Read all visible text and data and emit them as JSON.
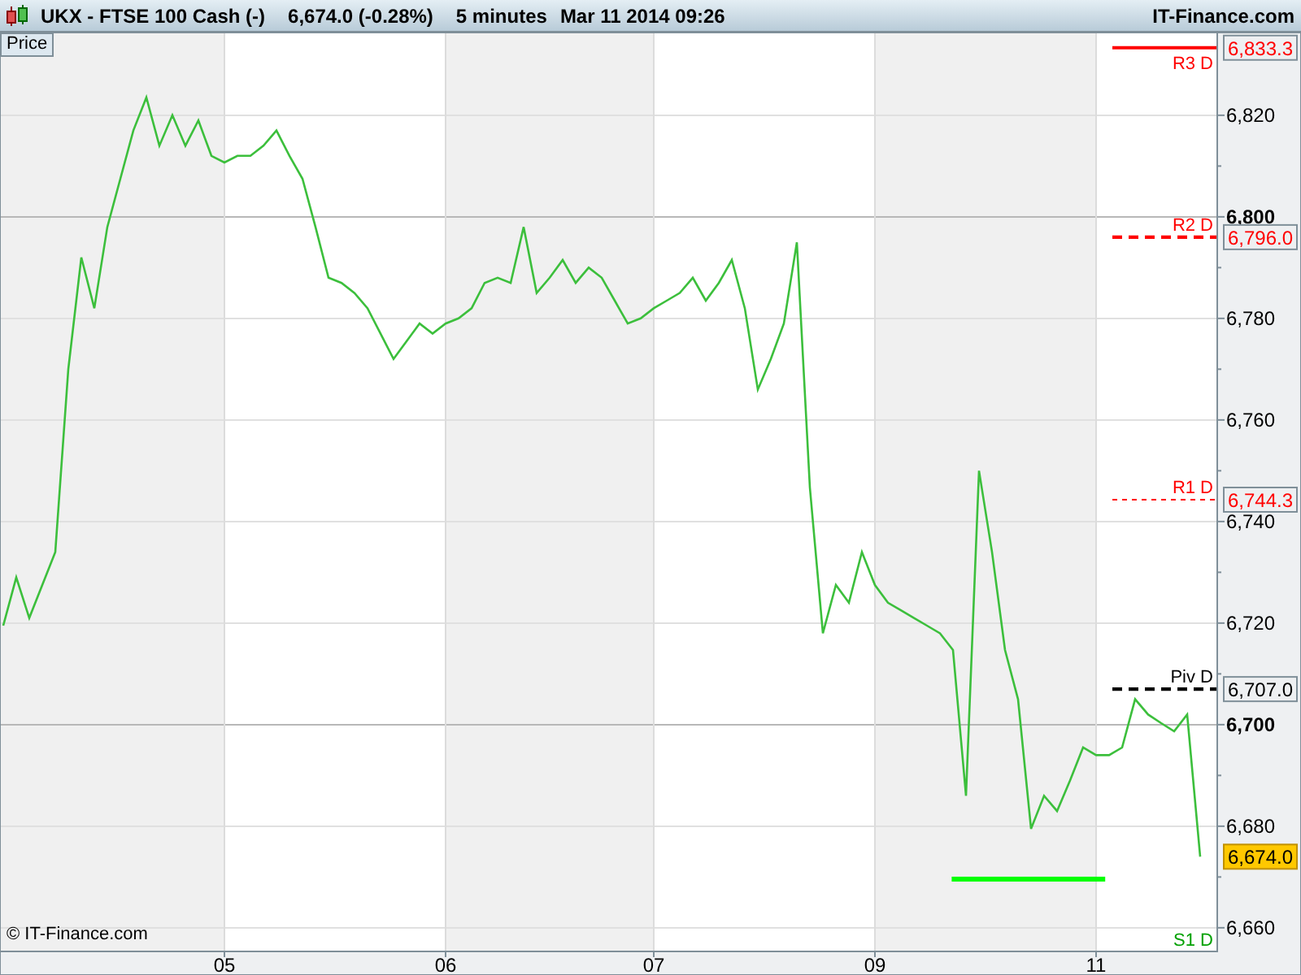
{
  "header": {
    "instrument": "UKX - FTSE 100 Cash (-)",
    "quote": "6,674.0 (-0.28%)",
    "interval": "5 minutes",
    "timestamp": "Mar 11 2014 09:26",
    "brand": "IT-Finance.com"
  },
  "chart": {
    "panel_label": "Price",
    "watermark": "© IT-Finance.com",
    "bottom_level_label": "S1 D",
    "price_tags": [
      {
        "kind": "level",
        "text": "6,833.3"
      },
      {
        "kind": "level",
        "text": "6,796.0"
      },
      {
        "kind": "level",
        "text": "6,744.3"
      },
      {
        "kind": "level",
        "text": "6,707.0"
      },
      {
        "kind": "last",
        "text": "6,674.0",
        "color": "#ffc800"
      }
    ],
    "chart_data": {
      "type": "line",
      "grid": true,
      "ylim": [
        6655.5,
        6836.3
      ],
      "categories": [
        null,
        null,
        null,
        null,
        null,
        null,
        null,
        null,
        null,
        null,
        null,
        null,
        null,
        null,
        null,
        null,
        null,
        "05",
        null,
        null,
        null,
        null,
        null,
        null,
        null,
        null,
        null,
        null,
        null,
        null,
        null,
        null,
        null,
        null,
        "06",
        null,
        null,
        null,
        null,
        null,
        null,
        null,
        null,
        null,
        null,
        null,
        null,
        null,
        null,
        null,
        "07",
        null,
        null,
        null,
        null,
        null,
        null,
        null,
        null,
        null,
        null,
        null,
        null,
        null,
        null,
        null,
        null,
        "09",
        null,
        null,
        null,
        null,
        null,
        null,
        null,
        null,
        null,
        null,
        null,
        null,
        null,
        null,
        null,
        null,
        "11",
        null,
        null,
        null,
        null,
        null,
        null,
        null,
        null
      ],
      "yticks": [
        {
          "value": 6660,
          "label": "6,660"
        },
        {
          "value": 6680,
          "label": "6,680"
        },
        {
          "value": 6700,
          "label": "6,700"
        },
        {
          "value": 6720,
          "label": "6,720"
        },
        {
          "value": 6740,
          "label": "6,740"
        },
        {
          "value": 6760,
          "label": "6,760"
        },
        {
          "value": 6780,
          "label": "6,780"
        },
        {
          "value": 6800,
          "label": "6,800"
        },
        {
          "value": 6820,
          "label": "6,820"
        }
      ],
      "series": [
        {
          "color": "#3cbf3c",
          "values": [
            6719.5,
            6729,
            6721,
            6727.5,
            6734,
            6770,
            6792,
            6782,
            6798,
            6807.5,
            6817,
            6823.5,
            6814,
            6820,
            6814,
            6819,
            6812,
            6810.7,
            6812,
            6812,
            6814,
            6817,
            6812,
            6807.5,
            6798,
            6788,
            6787,
            6785,
            6782,
            6777,
            6772,
            6775.5,
            6779,
            6777,
            6779,
            6780,
            6782,
            6787,
            6788,
            6787,
            6798,
            6785,
            6788,
            6791.5,
            6787,
            6790,
            6788,
            6783.5,
            6779,
            6780,
            6782,
            6783.5,
            6785,
            6788,
            6783.5,
            6787,
            6791.5,
            6782,
            6766,
            6772,
            6779,
            6795,
            6746.7,
            6718,
            6727.5,
            6724,
            6734,
            6727.5,
            6724,
            6722.5,
            6721,
            6719.5,
            6718,
            6714.7,
            6686,
            6750,
            6734,
            6714.7,
            6705,
            6679.5,
            6686,
            6683,
            6689,
            6695.5,
            6694,
            6694,
            6695.5,
            6705,
            6702,
            6700.3,
            6698.7,
            6702,
            6674
          ]
        }
      ],
      "ref_lines": [
        {
          "axis": "y",
          "value": 6833.3,
          "label": "R3 D",
          "color": "#ff0000"
        },
        {
          "axis": "y",
          "value": 6796.0,
          "label": "R2 D",
          "color": "#ff0000"
        },
        {
          "axis": "y",
          "value": 6744.3,
          "label": "R1 D",
          "color": "#ff0000"
        },
        {
          "axis": "y",
          "value": 6707.0,
          "label": "Piv D",
          "color": "#000000"
        }
      ]
    }
  }
}
